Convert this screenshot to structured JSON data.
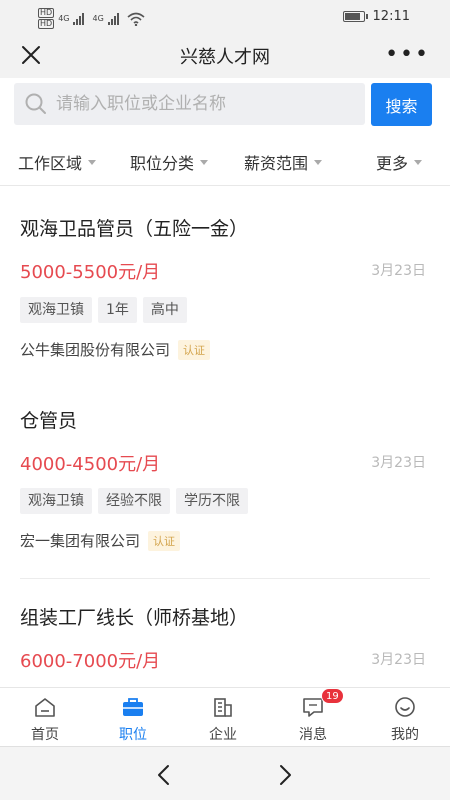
{
  "status_bar": {
    "time": "12:11",
    "network_left": "HD",
    "network_right": "HD",
    "signal1": "4G",
    "signal2": "4G",
    "icons": [
      "wifi-icon",
      "battery-icon"
    ]
  },
  "title_bar": {
    "title": "兴慈人才网",
    "more_label": "•••"
  },
  "search": {
    "placeholder": "请输入职位或企业名称",
    "button_label": "搜索"
  },
  "filters": [
    {
      "label": "工作区域"
    },
    {
      "label": "职位分类"
    },
    {
      "label": "薪资范围"
    },
    {
      "label": "更多"
    }
  ],
  "jobs": [
    {
      "title": "观海卫品管员（五险一金）",
      "salary": "5000-5500元/月",
      "date": "3月23日",
      "tags": [
        "观海卫镇",
        "1年",
        "高中"
      ],
      "company": "公牛集团股份有限公司",
      "verified": "认证"
    },
    {
      "title": "仓管员",
      "salary": "4000-4500元/月",
      "date": "3月23日",
      "tags": [
        "观海卫镇",
        "经验不限",
        "学历不限"
      ],
      "company": "宏一集团有限公司",
      "verified": "认证"
    },
    {
      "title": "组装工厂线长（师桥基地）",
      "salary": "6000-7000元/月",
      "date": "3月23日"
    }
  ],
  "tabs": [
    {
      "label": "首页",
      "icon": "home-icon"
    },
    {
      "label": "职位",
      "icon": "briefcase-icon",
      "active": true
    },
    {
      "label": "企业",
      "icon": "building-icon"
    },
    {
      "label": "消息",
      "icon": "message-icon",
      "badge": "19"
    },
    {
      "label": "我的",
      "icon": "profile-icon"
    }
  ],
  "colors": {
    "accent": "#1a7ff0",
    "salary": "#e64a50",
    "badge": "#e8323c",
    "verified_bg": "#fdf3de",
    "verified_text": "#d3a44d"
  }
}
